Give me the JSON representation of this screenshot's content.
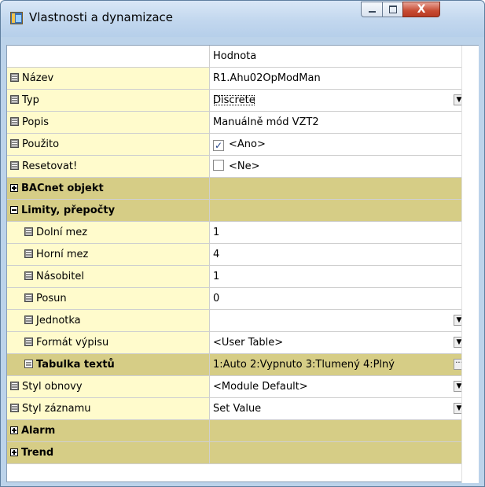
{
  "window": {
    "title": "Vlastnosti a dynamizace",
    "controls": {
      "minimize": "",
      "maximize": "",
      "close": "X"
    }
  },
  "grid": {
    "header": {
      "name": "",
      "value": "Hodnota"
    },
    "rows": [
      {
        "kind": "prop",
        "name": "Název",
        "value": "R1.Ahu02OpModMan"
      },
      {
        "kind": "prop",
        "name": "Typ",
        "value": "Discrete",
        "dropdown": true
      },
      {
        "kind": "prop",
        "name": "Popis",
        "value": "Manuálně mód VZT2"
      },
      {
        "kind": "prop",
        "name": "Použito",
        "value": "<Ano>",
        "checked": true
      },
      {
        "kind": "prop",
        "name": "Resetovat!",
        "value": "<Ne>",
        "checked": false
      },
      {
        "kind": "group",
        "name": "BACnet objekt",
        "expanded": false
      },
      {
        "kind": "group",
        "name": "Limity, přepočty",
        "expanded": true
      },
      {
        "kind": "prop",
        "name": "Dolní mez",
        "value": "1"
      },
      {
        "kind": "prop",
        "name": "Horní mez",
        "value": "4"
      },
      {
        "kind": "prop",
        "name": "Násobitel",
        "value": "1"
      },
      {
        "kind": "prop",
        "name": "Posun",
        "value": "0"
      },
      {
        "kind": "prop",
        "name": "Jednotka",
        "value": ""
      },
      {
        "kind": "prop",
        "name": "Formát výpisu",
        "value": "<User Table>"
      },
      {
        "kind": "group",
        "name": "Tabulka textů",
        "value": "1:Auto 2:Vypnuto 3:Tlumený 4:Plný"
      },
      {
        "kind": "prop",
        "name": "Styl obnovy",
        "value": "<Module Default>"
      },
      {
        "kind": "prop",
        "name": "Styl záznamu",
        "value": "Set Value"
      },
      {
        "kind": "group",
        "name": "Alarm",
        "expanded": false
      },
      {
        "kind": "group",
        "name": "Trend",
        "expanded": false
      }
    ]
  },
  "glyphs": {
    "dropdown_arrow": "▼",
    "ellipsis": "···",
    "check": "✓"
  },
  "colors": {
    "property_name_bg": "#fffbcc",
    "group_bg": "#d6cd86",
    "titlebar": "#c2d7ee",
    "close_button": "#c74b32"
  }
}
